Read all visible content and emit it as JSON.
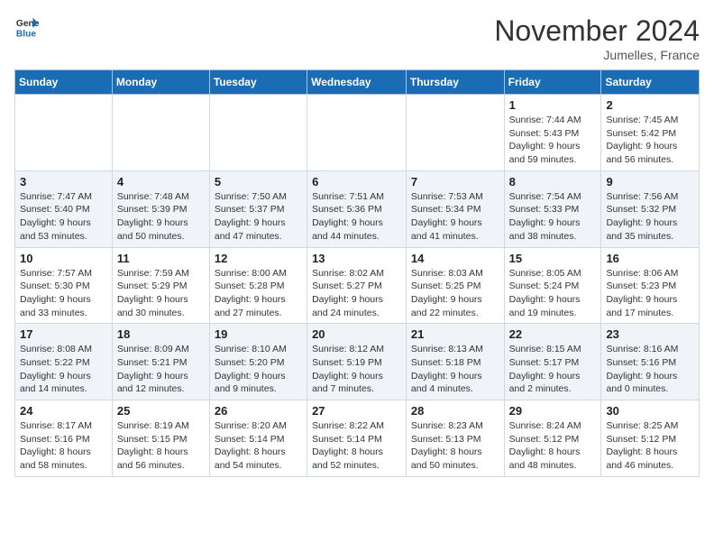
{
  "header": {
    "logo_line1": "General",
    "logo_line2": "Blue",
    "month": "November 2024",
    "location": "Jumelles, France"
  },
  "days_of_week": [
    "Sunday",
    "Monday",
    "Tuesday",
    "Wednesday",
    "Thursday",
    "Friday",
    "Saturday"
  ],
  "weeks": [
    [
      null,
      null,
      null,
      null,
      null,
      {
        "day": 1,
        "sunrise": "Sunrise: 7:44 AM",
        "sunset": "Sunset: 5:43 PM",
        "daylight": "Daylight: 9 hours and 59 minutes."
      },
      {
        "day": 2,
        "sunrise": "Sunrise: 7:45 AM",
        "sunset": "Sunset: 5:42 PM",
        "daylight": "Daylight: 9 hours and 56 minutes."
      }
    ],
    [
      {
        "day": 3,
        "sunrise": "Sunrise: 7:47 AM",
        "sunset": "Sunset: 5:40 PM",
        "daylight": "Daylight: 9 hours and 53 minutes."
      },
      {
        "day": 4,
        "sunrise": "Sunrise: 7:48 AM",
        "sunset": "Sunset: 5:39 PM",
        "daylight": "Daylight: 9 hours and 50 minutes."
      },
      {
        "day": 5,
        "sunrise": "Sunrise: 7:50 AM",
        "sunset": "Sunset: 5:37 PM",
        "daylight": "Daylight: 9 hours and 47 minutes."
      },
      {
        "day": 6,
        "sunrise": "Sunrise: 7:51 AM",
        "sunset": "Sunset: 5:36 PM",
        "daylight": "Daylight: 9 hours and 44 minutes."
      },
      {
        "day": 7,
        "sunrise": "Sunrise: 7:53 AM",
        "sunset": "Sunset: 5:34 PM",
        "daylight": "Daylight: 9 hours and 41 minutes."
      },
      {
        "day": 8,
        "sunrise": "Sunrise: 7:54 AM",
        "sunset": "Sunset: 5:33 PM",
        "daylight": "Daylight: 9 hours and 38 minutes."
      },
      {
        "day": 9,
        "sunrise": "Sunrise: 7:56 AM",
        "sunset": "Sunset: 5:32 PM",
        "daylight": "Daylight: 9 hours and 35 minutes."
      }
    ],
    [
      {
        "day": 10,
        "sunrise": "Sunrise: 7:57 AM",
        "sunset": "Sunset: 5:30 PM",
        "daylight": "Daylight: 9 hours and 33 minutes."
      },
      {
        "day": 11,
        "sunrise": "Sunrise: 7:59 AM",
        "sunset": "Sunset: 5:29 PM",
        "daylight": "Daylight: 9 hours and 30 minutes."
      },
      {
        "day": 12,
        "sunrise": "Sunrise: 8:00 AM",
        "sunset": "Sunset: 5:28 PM",
        "daylight": "Daylight: 9 hours and 27 minutes."
      },
      {
        "day": 13,
        "sunrise": "Sunrise: 8:02 AM",
        "sunset": "Sunset: 5:27 PM",
        "daylight": "Daylight: 9 hours and 24 minutes."
      },
      {
        "day": 14,
        "sunrise": "Sunrise: 8:03 AM",
        "sunset": "Sunset: 5:25 PM",
        "daylight": "Daylight: 9 hours and 22 minutes."
      },
      {
        "day": 15,
        "sunrise": "Sunrise: 8:05 AM",
        "sunset": "Sunset: 5:24 PM",
        "daylight": "Daylight: 9 hours and 19 minutes."
      },
      {
        "day": 16,
        "sunrise": "Sunrise: 8:06 AM",
        "sunset": "Sunset: 5:23 PM",
        "daylight": "Daylight: 9 hours and 17 minutes."
      }
    ],
    [
      {
        "day": 17,
        "sunrise": "Sunrise: 8:08 AM",
        "sunset": "Sunset: 5:22 PM",
        "daylight": "Daylight: 9 hours and 14 minutes."
      },
      {
        "day": 18,
        "sunrise": "Sunrise: 8:09 AM",
        "sunset": "Sunset: 5:21 PM",
        "daylight": "Daylight: 9 hours and 12 minutes."
      },
      {
        "day": 19,
        "sunrise": "Sunrise: 8:10 AM",
        "sunset": "Sunset: 5:20 PM",
        "daylight": "Daylight: 9 hours and 9 minutes."
      },
      {
        "day": 20,
        "sunrise": "Sunrise: 8:12 AM",
        "sunset": "Sunset: 5:19 PM",
        "daylight": "Daylight: 9 hours and 7 minutes."
      },
      {
        "day": 21,
        "sunrise": "Sunrise: 8:13 AM",
        "sunset": "Sunset: 5:18 PM",
        "daylight": "Daylight: 9 hours and 4 minutes."
      },
      {
        "day": 22,
        "sunrise": "Sunrise: 8:15 AM",
        "sunset": "Sunset: 5:17 PM",
        "daylight": "Daylight: 9 hours and 2 minutes."
      },
      {
        "day": 23,
        "sunrise": "Sunrise: 8:16 AM",
        "sunset": "Sunset: 5:16 PM",
        "daylight": "Daylight: 9 hours and 0 minutes."
      }
    ],
    [
      {
        "day": 24,
        "sunrise": "Sunrise: 8:17 AM",
        "sunset": "Sunset: 5:16 PM",
        "daylight": "Daylight: 8 hours and 58 minutes."
      },
      {
        "day": 25,
        "sunrise": "Sunrise: 8:19 AM",
        "sunset": "Sunset: 5:15 PM",
        "daylight": "Daylight: 8 hours and 56 minutes."
      },
      {
        "day": 26,
        "sunrise": "Sunrise: 8:20 AM",
        "sunset": "Sunset: 5:14 PM",
        "daylight": "Daylight: 8 hours and 54 minutes."
      },
      {
        "day": 27,
        "sunrise": "Sunrise: 8:22 AM",
        "sunset": "Sunset: 5:14 PM",
        "daylight": "Daylight: 8 hours and 52 minutes."
      },
      {
        "day": 28,
        "sunrise": "Sunrise: 8:23 AM",
        "sunset": "Sunset: 5:13 PM",
        "daylight": "Daylight: 8 hours and 50 minutes."
      },
      {
        "day": 29,
        "sunrise": "Sunrise: 8:24 AM",
        "sunset": "Sunset: 5:12 PM",
        "daylight": "Daylight: 8 hours and 48 minutes."
      },
      {
        "day": 30,
        "sunrise": "Sunrise: 8:25 AM",
        "sunset": "Sunset: 5:12 PM",
        "daylight": "Daylight: 8 hours and 46 minutes."
      }
    ]
  ]
}
